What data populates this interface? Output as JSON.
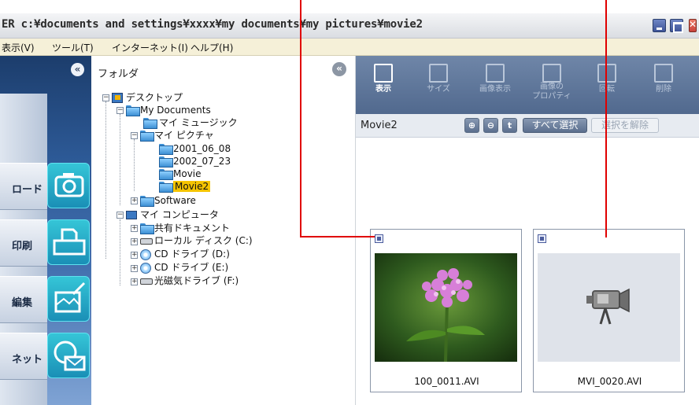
{
  "window": {
    "title": "ER c:¥documents and settings¥xxxx¥my documents¥my pictures¥movie2"
  },
  "menu": [
    "表示(V)",
    "ツール(T)",
    "インターネット(I)",
    "ヘルプ(H)"
  ],
  "sidebar": {
    "collapse": "«",
    "items": [
      {
        "label": "ロード",
        "icon": "camera-icon"
      },
      {
        "label": "印刷",
        "icon": "printer-icon"
      },
      {
        "label": "編集",
        "icon": "edit-icon"
      },
      {
        "label": "ネット",
        "icon": "internet-mail-icon"
      }
    ]
  },
  "folders": {
    "header": "フォルダ",
    "collapse": "«",
    "tree": {
      "desktop": "デスクトップ",
      "my_documents": "My Documents",
      "my_music": "マイ ミュージック",
      "my_pictures": "マイ ピクチャ",
      "f1": "2001_06_08",
      "f2": "2002_07_23",
      "f3": "Movie",
      "f4": "Movie2",
      "software": "Software",
      "my_computer": "マイ コンピュータ",
      "shared": "共有ドキュメント",
      "local_disk": "ローカル ディスク (C:)",
      "cd_d": "CD ドライブ (D:)",
      "cd_e": "CD ドライブ (E:)",
      "mo_f": "光磁気ドライブ (F:)"
    }
  },
  "toolbar": {
    "view": "表示",
    "size": "サイズ",
    "image_view": "画像表示",
    "props_line1": "画像の",
    "props_line2": "プロパティ",
    "rotate": "回転",
    "delete": "削除"
  },
  "pathbar": {
    "folder": "Movie2",
    "zoom_in": "⊕",
    "zoom_out": "⊖",
    "up": "t",
    "select_all": "すべて選択",
    "deselect": "選択を解除"
  },
  "files": [
    {
      "name": "100_0011.AVI"
    },
    {
      "name": "MVI_0020.AVI"
    }
  ],
  "colors": {
    "accent_red": "#e00000",
    "selected_folder": "#f5c400",
    "toolbar": "#5f7899"
  }
}
